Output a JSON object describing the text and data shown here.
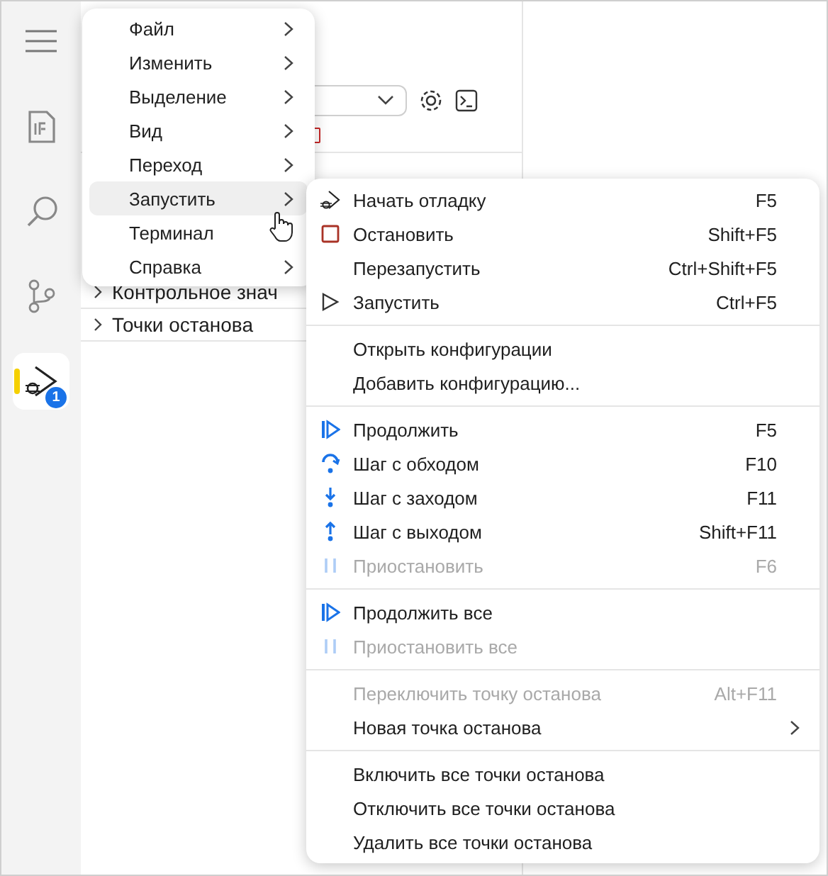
{
  "activity_bar": {
    "items": [
      {
        "kind": "menu",
        "selected": false
      },
      {
        "kind": "document",
        "selected": false
      },
      {
        "kind": "search",
        "selected": false
      },
      {
        "kind": "source_control",
        "selected": false
      },
      {
        "kind": "debug",
        "selected": true,
        "badge": "1"
      }
    ]
  },
  "side_panel": {
    "tree": [
      {
        "label": "Контрольное знач",
        "expanded": false
      },
      {
        "label": "Точки останова",
        "expanded": false
      }
    ]
  },
  "main_menu": {
    "items": [
      {
        "label": "Файл",
        "submenu": true,
        "selected": false
      },
      {
        "label": "Изменить",
        "submenu": true,
        "selected": false
      },
      {
        "label": "Выделение",
        "submenu": true,
        "selected": false
      },
      {
        "label": "Вид",
        "submenu": true,
        "selected": false
      },
      {
        "label": "Переход",
        "submenu": true,
        "selected": false
      },
      {
        "label": "Запустить",
        "submenu": true,
        "selected": true
      },
      {
        "label": "Терминал",
        "submenu": false,
        "selected": false
      },
      {
        "label": "Справка",
        "submenu": true,
        "selected": false
      }
    ]
  },
  "run_menu": {
    "groups": [
      [
        {
          "kind": "debug",
          "label": "Начать отладку",
          "shortcut": "F5",
          "disabled": false,
          "submenu": false
        },
        {
          "kind": "stop",
          "label": "Остановить",
          "shortcut": "Shift+F5",
          "disabled": false,
          "submenu": false
        },
        {
          "kind": "plain",
          "label": "Перезапустить",
          "shortcut": "Ctrl+Shift+F5",
          "disabled": false,
          "submenu": false
        },
        {
          "kind": "run",
          "label": "Запустить",
          "shortcut": "Ctrl+F5",
          "disabled": false,
          "submenu": false
        }
      ],
      [
        {
          "kind": "plain",
          "label": "Открыть конфигурации",
          "disabled": false,
          "submenu": false
        },
        {
          "kind": "plain",
          "label": "Добавить конфигурацию...",
          "disabled": false,
          "submenu": false
        }
      ],
      [
        {
          "kind": "continue",
          "label": "Продолжить",
          "shortcut": "F5",
          "disabled": false,
          "submenu": false
        },
        {
          "kind": "step_over",
          "label": "Шаг с обходом",
          "shortcut": "F10",
          "disabled": false,
          "submenu": false
        },
        {
          "kind": "step_into",
          "label": "Шаг с заходом",
          "shortcut": "F11",
          "disabled": false,
          "submenu": false
        },
        {
          "kind": "step_out",
          "label": "Шаг с выходом",
          "shortcut": "Shift+F11",
          "disabled": false,
          "submenu": false
        },
        {
          "kind": "pause",
          "label": "Приостановить",
          "shortcut": "F6",
          "disabled": true,
          "submenu": false
        }
      ],
      [
        {
          "kind": "continue",
          "label": "Продолжить все",
          "disabled": false,
          "submenu": false
        },
        {
          "kind": "pause",
          "label": "Приостановить все",
          "disabled": true,
          "submenu": false
        }
      ],
      [
        {
          "kind": "plain",
          "label": "Переключить точку останова",
          "shortcut": "Alt+F11",
          "disabled": true,
          "submenu": false
        },
        {
          "kind": "plain",
          "label": "Новая точка останова",
          "disabled": false,
          "submenu": true
        }
      ],
      [
        {
          "kind": "plain",
          "label": "Включить все точки останова",
          "disabled": false,
          "submenu": false
        },
        {
          "kind": "plain",
          "label": "Отключить все точки останова",
          "disabled": false,
          "submenu": false
        },
        {
          "kind": "plain",
          "label": "Удалить все точки останова",
          "disabled": false,
          "submenu": false
        }
      ]
    ]
  }
}
